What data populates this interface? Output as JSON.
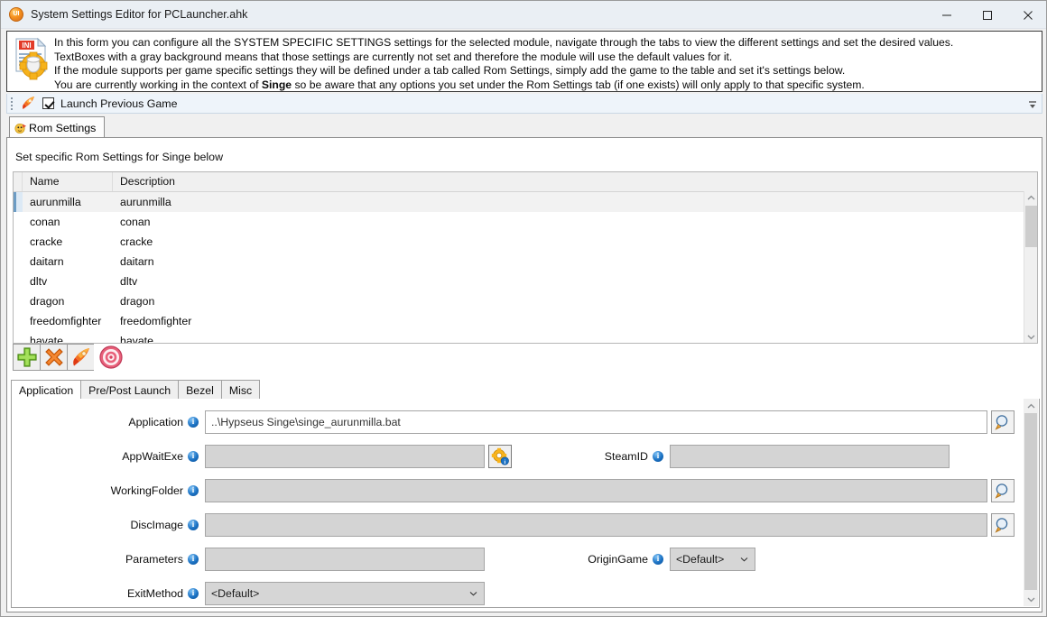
{
  "window": {
    "title": "System Settings Editor for PCLauncher.ahk",
    "icon": "app-icon",
    "minimize_label": "Minimize",
    "maximize_label": "Maximize",
    "close_label": "Close"
  },
  "info": {
    "icon": "ini-gear-icon",
    "line1": "In this form you can configure all the SYSTEM SPECIFIC SETTINGS settings for the selected module, navigate through the tabs to view the different settings and set the desired values.",
    "line2": "TextBoxes with a gray background means that those settings are currently not set and therefore the module will use the default values for it.",
    "line3": "If the module supports per game specific settings they will be defined under a tab called Rom Settings, simply add the game to the table and set it's settings below.",
    "line4_a": "You are currently working in the context of ",
    "line4_bold": "Singe",
    "line4_b": " so be aware that any options you set under the Rom Settings tab (if one exists) will only apply to that specific system."
  },
  "launch_bar": {
    "icon": "rocket-icon",
    "checkbox_label": "Launch Previous Game",
    "checked": true,
    "overflow_icon": "toolbar-overflow-icon"
  },
  "rom_tab": {
    "icon": "rom-settings-icon",
    "label": "Rom Settings"
  },
  "main": {
    "caption": "Set specific Rom Settings for Singe below"
  },
  "table": {
    "columns": [
      "Name",
      "Description"
    ],
    "rows": [
      {
        "name": "aurunmilla",
        "description": "aurunmilla",
        "selected": true
      },
      {
        "name": "conan",
        "description": "conan",
        "selected": false
      },
      {
        "name": "cracke",
        "description": "cracke",
        "selected": false
      },
      {
        "name": "daitarn",
        "description": "daitarn",
        "selected": false
      },
      {
        "name": "dltv",
        "description": "dltv",
        "selected": false
      },
      {
        "name": "dragon",
        "description": "dragon",
        "selected": false
      },
      {
        "name": "freedomfighter",
        "description": "freedomfighter",
        "selected": false
      },
      {
        "name": "havate",
        "description": "havate",
        "selected": false
      }
    ],
    "scroll_up_icon": "chevron-up-icon",
    "scroll_down_icon": "chevron-down-icon"
  },
  "toolbar": {
    "add_icon": "green-plus-icon",
    "delete_icon": "orange-x-icon",
    "launch_icon": "rocket-icon",
    "target_icon": "bullseye-target-icon"
  },
  "tabs": [
    {
      "label": "Application",
      "active": true
    },
    {
      "label": "Pre/Post Launch",
      "active": false
    },
    {
      "label": "Bezel",
      "active": false
    },
    {
      "label": "Misc",
      "active": false
    }
  ],
  "form": {
    "application": {
      "label": "Application",
      "value": "..\\Hypseus Singe\\singe_aurunmilla.bat",
      "filled": true,
      "info_icon": "info-icon",
      "browse_icon": "magnifier-icon"
    },
    "appwaitexe": {
      "label": "AppWaitExe",
      "value": "",
      "filled": false,
      "info_icon": "info-icon",
      "gear_icon": "gear-info-icon"
    },
    "steamid": {
      "label": "SteamID",
      "value": "",
      "filled": false,
      "info_icon": "info-icon"
    },
    "workingfolder": {
      "label": "WorkingFolder",
      "value": "",
      "filled": false,
      "info_icon": "info-icon",
      "browse_icon": "magnifier-icon"
    },
    "discimage": {
      "label": "DiscImage",
      "value": "",
      "filled": false,
      "info_icon": "info-icon",
      "browse_icon": "magnifier-icon"
    },
    "parameters": {
      "label": "Parameters",
      "value": "",
      "filled": false,
      "info_icon": "info-icon"
    },
    "origingame": {
      "label": "OriginGame",
      "value": "<Default>",
      "info_icon": "info-icon",
      "chevron_icon": "chevron-down-icon"
    },
    "exitmethod": {
      "label": "ExitMethod",
      "value": "<Default>",
      "info_icon": "info-icon",
      "chevron_icon": "chevron-down-icon"
    }
  },
  "colors": {
    "titlebar": "#eaeff4",
    "accent_blue": "#1b72c4",
    "unset_field": "#d4d4d4",
    "selection": "#f2f2f2",
    "selection_marker": "#6c9cc4"
  }
}
